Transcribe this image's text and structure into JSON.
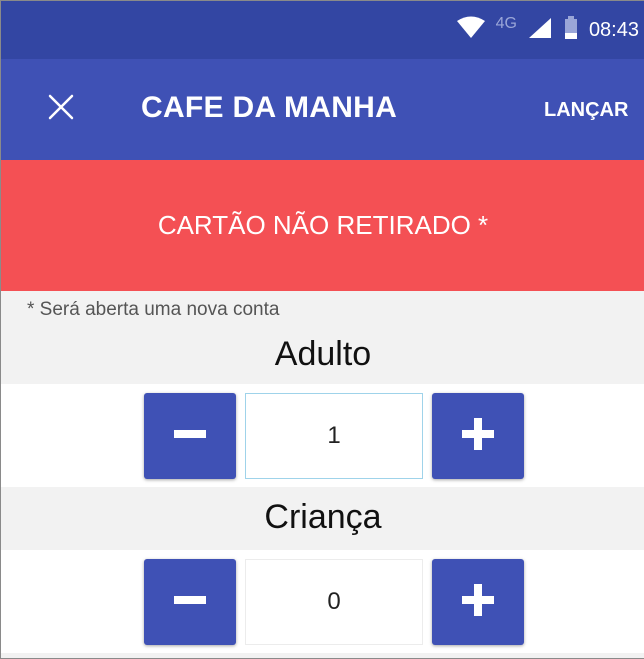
{
  "status_bar": {
    "network_type": "4G",
    "time": "08:43",
    "icons": [
      "wifi-icon",
      "signal-icon",
      "battery-icon"
    ]
  },
  "app_bar": {
    "title": "CAFE DA MANHA",
    "action_label": "LANÇAR",
    "close_icon": "close-icon"
  },
  "warning": {
    "text": "CARTÃO NÃO RETIRADO *"
  },
  "note": "* Será aberta uma nova conta",
  "counters": {
    "adult": {
      "label": "Adulto",
      "value": "1"
    },
    "child": {
      "label": "Criança",
      "value": "0"
    }
  },
  "colors": {
    "primary": "#3f51b5",
    "status_bar": "#3346a3",
    "warning": "#f45054",
    "background": "#f2f2f2"
  }
}
